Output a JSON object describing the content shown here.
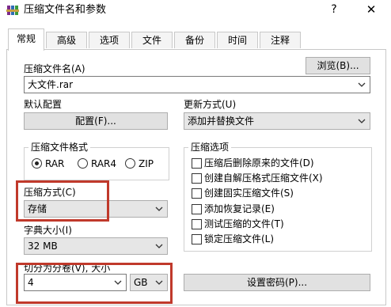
{
  "window": {
    "title": "压缩文件名和参数",
    "help": "?",
    "close": "✕"
  },
  "tabs": [
    {
      "label": "常规"
    },
    {
      "label": "高级"
    },
    {
      "label": "选项"
    },
    {
      "label": "文件"
    },
    {
      "label": "备份"
    },
    {
      "label": "时间"
    },
    {
      "label": "注释"
    }
  ],
  "archive": {
    "name_label": "压缩文件名(A)",
    "browse": "浏览(B)...",
    "name_value": "大文件.rar"
  },
  "profile": {
    "label": "默认配置",
    "button": "配置(F)..."
  },
  "update": {
    "label": "更新方式(U)",
    "value": "添加并替换文件"
  },
  "format": {
    "title": "压缩文件格式",
    "options": [
      {
        "label": "RAR",
        "selected": true
      },
      {
        "label": "RAR4",
        "selected": false
      },
      {
        "label": "ZIP",
        "selected": false
      }
    ]
  },
  "method": {
    "label": "压缩方式(C)",
    "value": "存储"
  },
  "dict": {
    "label": "字典大小(I)",
    "value": "32 MB"
  },
  "split": {
    "label": "切分为分卷(V), 大小",
    "value": "4",
    "unit": "GB"
  },
  "options": {
    "title": "压缩选项",
    "items": [
      {
        "label": "压缩后删除原来的文件(D)"
      },
      {
        "label": "创建自解压格式压缩文件(X)"
      },
      {
        "label": "创建固实压缩文件(S)"
      },
      {
        "label": "添加恢复记录(E)"
      },
      {
        "label": "测试压缩的文件(T)"
      },
      {
        "label": "锁定压缩文件(L)"
      }
    ]
  },
  "password": {
    "button": "设置密码(P)..."
  },
  "colors": {
    "highlight": "#c0392b"
  },
  "icons": {
    "app": "winrar-books-icon",
    "dropdown": "chevron-down-icon"
  }
}
